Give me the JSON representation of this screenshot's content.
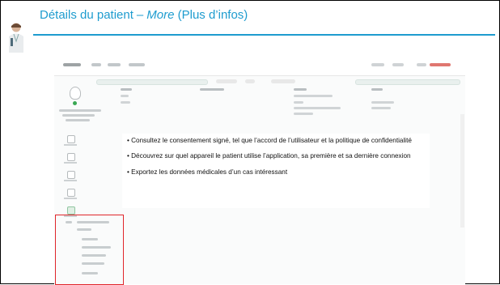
{
  "header": {
    "title_main": "Détails du patient",
    "title_dash": "–",
    "title_more": "More",
    "title_paren": "(Plus d’infos)"
  },
  "callout": {
    "bullets": [
      "• Consultez le consentement signé, tel que l’accord de l’utilisateur et la politique de confidentialité",
      "• Découvrez sur quel appareil le patient utilise l’application, sa première et sa dernière connexion",
      "• Exportez les données médicales d’un cas intéressant"
    ]
  },
  "colors": {
    "title": "#1e9ccf",
    "highlight_border": "#e0262b",
    "status_green": "#3aa854"
  }
}
